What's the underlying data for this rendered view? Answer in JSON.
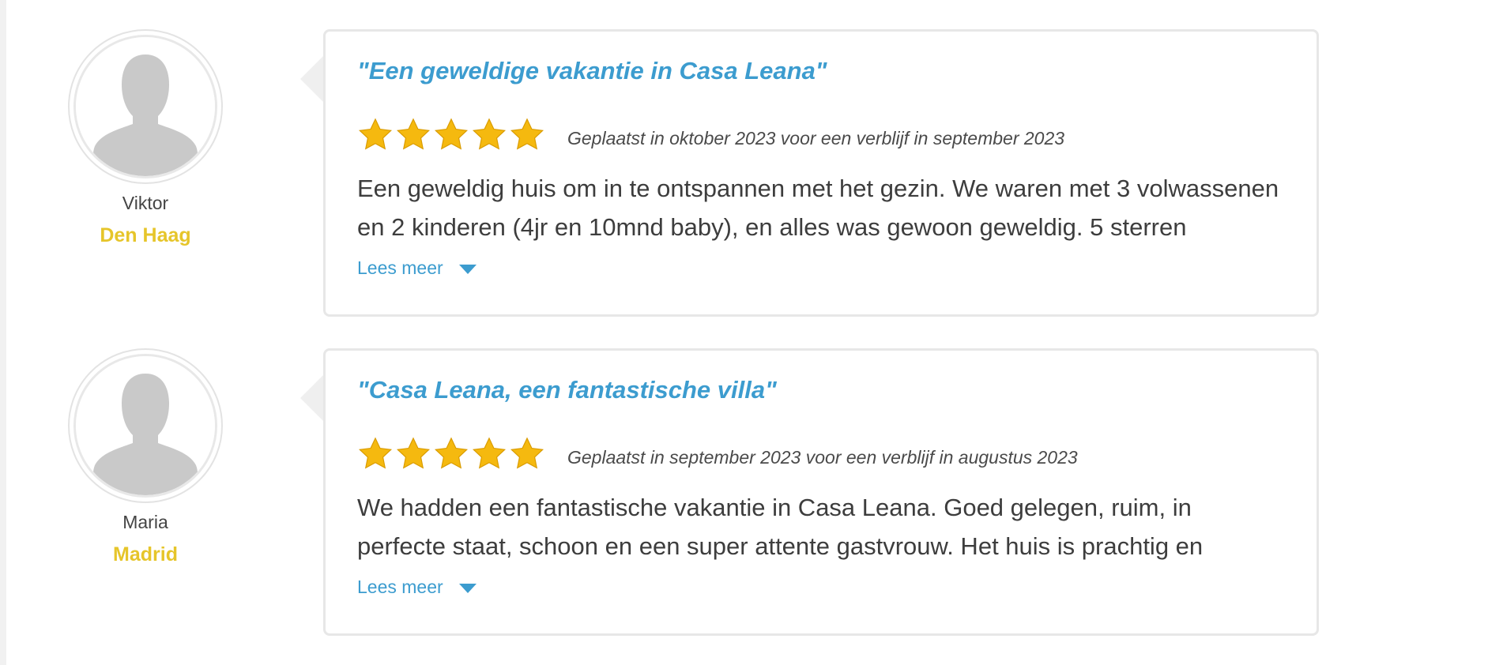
{
  "reviews": [
    {
      "author": {
        "name": "Viktor",
        "city": "Den Haag"
      },
      "title": "\"Een geweldige vakantie in Casa Leana\"",
      "rating": 5,
      "posted": "Geplaatst in oktober 2023 voor een verblijf in september 2023",
      "text": "Een geweldig huis om in te ontspannen met het gezin. We waren met 3 volwassenen en 2 kinderen (4jr en 10mnd baby), en alles was gewoon geweldig. 5 sterren",
      "read_more": "Lees meer"
    },
    {
      "author": {
        "name": "Maria",
        "city": "Madrid"
      },
      "title": "\"Casa Leana, een fantastische villa\"",
      "rating": 5,
      "posted": "Geplaatst in september 2023 voor een verblijf in augustus 2023",
      "text": "We hadden een fantastische vakantie in Casa Leana. Goed gelegen, ruim, in perfecte staat, schoon en een super attente gastvrouw. Het huis is prachtig en",
      "read_more": "Lees meer"
    }
  ],
  "colors": {
    "title": "#3c9ccf",
    "city": "#e6c52a",
    "star": "#f5b90f",
    "text": "#3d3d3d"
  },
  "icons": {
    "avatar": "user-silhouette-icon",
    "star": "star-icon",
    "chevron": "chevron-down-icon"
  }
}
